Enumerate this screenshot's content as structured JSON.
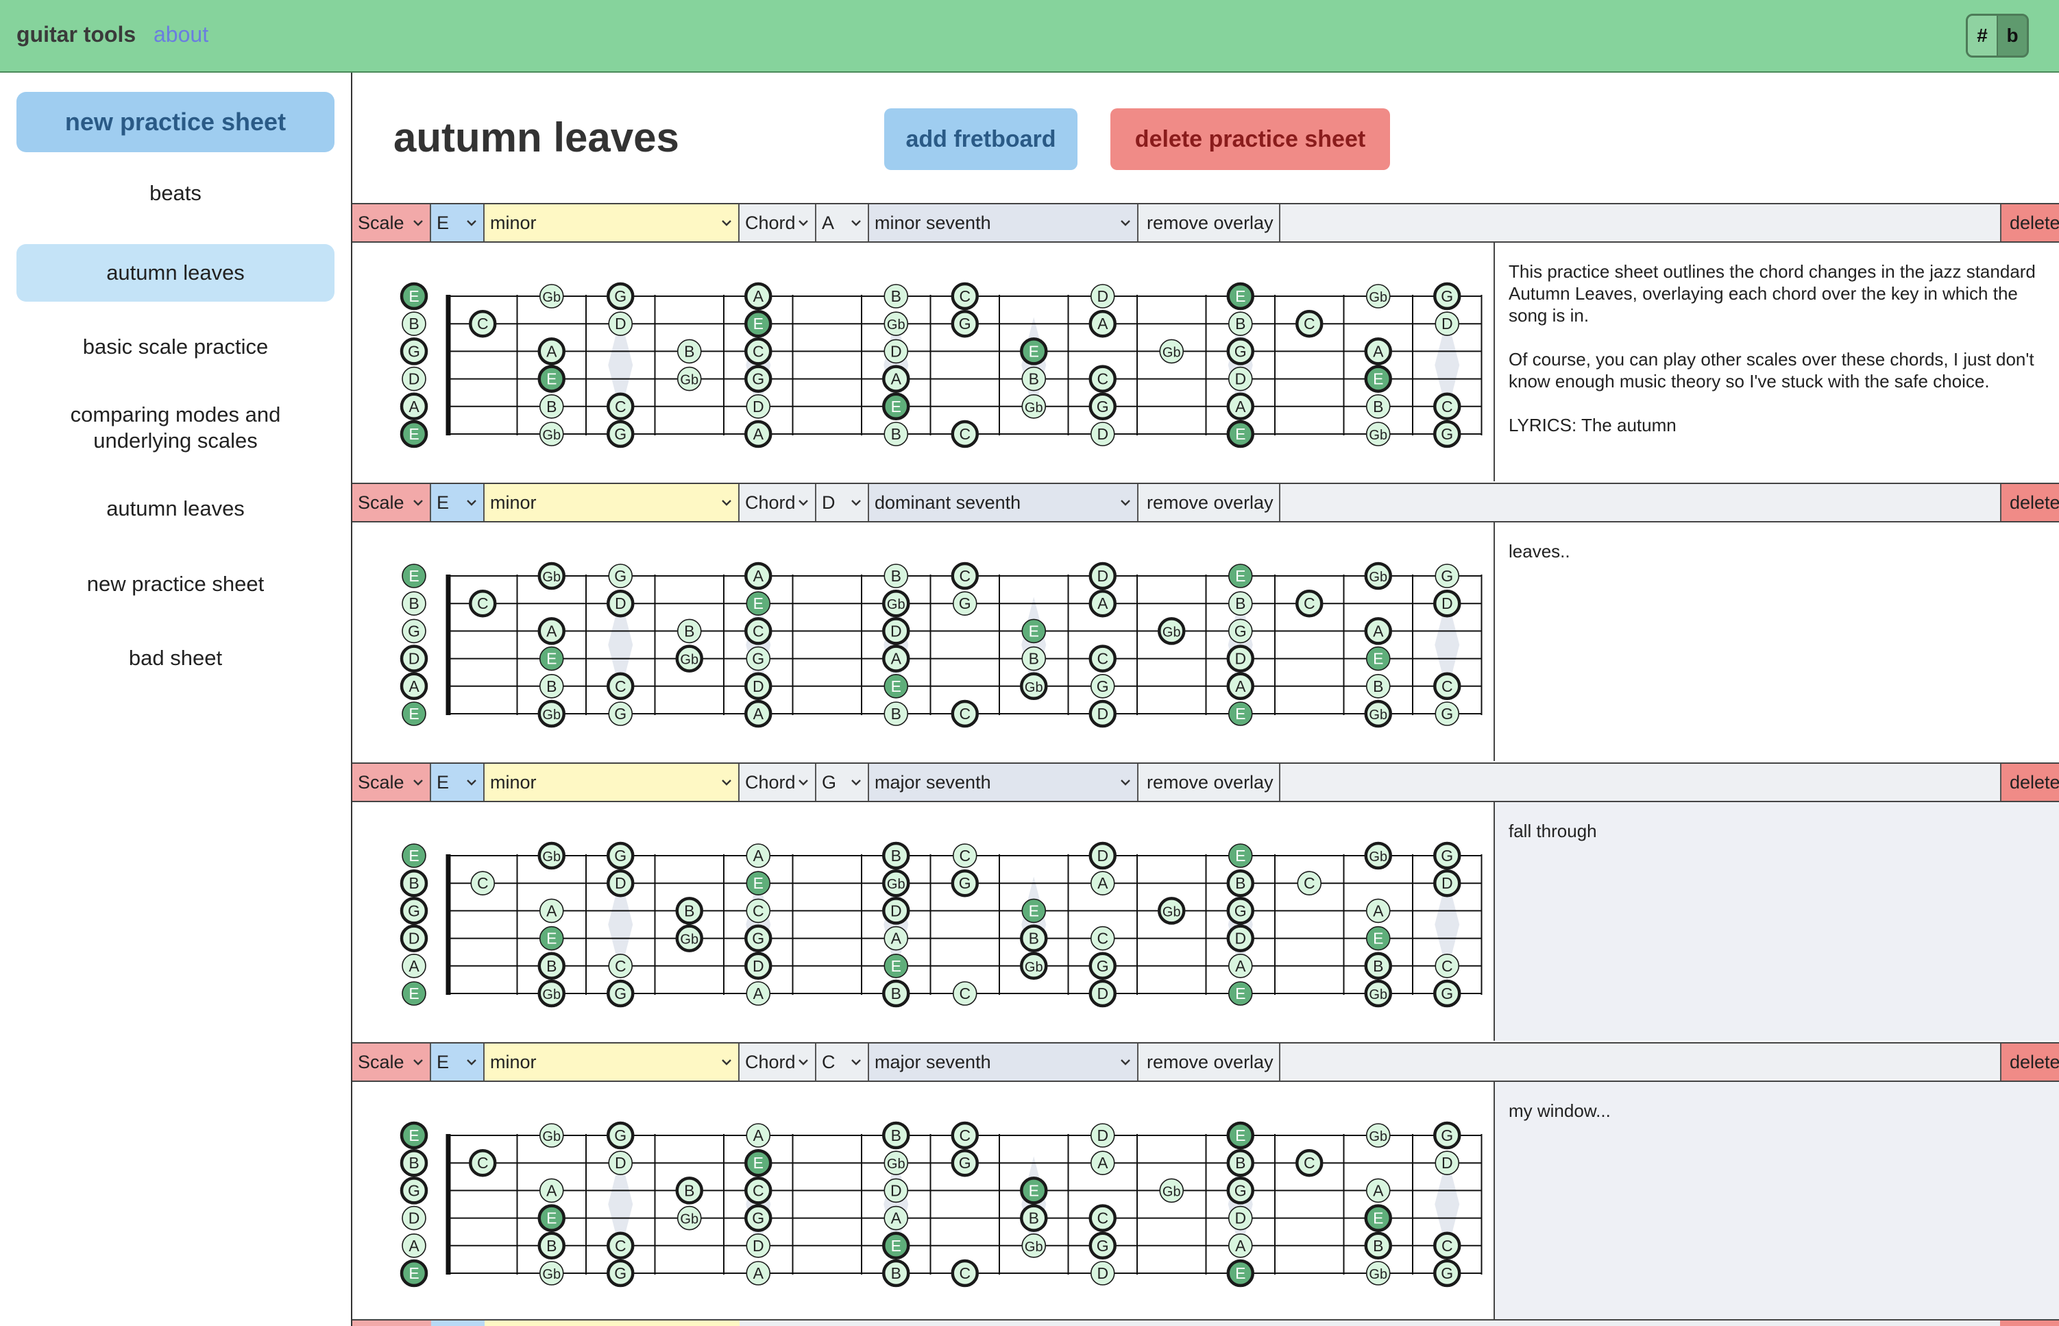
{
  "app": {
    "title": "guitar tools",
    "about_link": "about"
  },
  "accidentals": {
    "sharp": "#",
    "flat": "b",
    "selected": "b"
  },
  "sidebar": {
    "new_button": "new practice sheet",
    "items": [
      {
        "label": "beats",
        "active": false
      },
      {
        "label": "autumn leaves",
        "active": true
      },
      {
        "label": "basic scale practice",
        "active": false
      },
      {
        "label": "comparing modes and underlying scales",
        "active": false
      },
      {
        "label": "autumn leaves",
        "active": false
      },
      {
        "label": "new practice sheet",
        "active": false
      },
      {
        "label": "bad sheet",
        "active": false
      }
    ]
  },
  "sheet": {
    "title": "autumn leaves",
    "add_fretboard_label": "add fretboard",
    "delete_sheet_label": "delete practice sheet"
  },
  "controls": {
    "scale_label": "Scale",
    "chord_label": "Chord",
    "remove_overlay_label": "remove overlay",
    "delete_label": "delete"
  },
  "colors": {
    "topbar": "#86d39c",
    "note_fill_light": "#d9f5df",
    "note_fill_root": "#5fae7a",
    "scale_label_bg": "#f2a9a9",
    "scale_root_bg": "#b8d9f5",
    "scale_type_bg": "#fef8c4",
    "delete_bg": "#f08b87"
  },
  "fretboard": {
    "string_notes": [
      "E",
      "B",
      "G",
      "D",
      "A",
      "E"
    ],
    "frets": [
      [
        "E",
        "B",
        "G",
        "D",
        "A",
        "E"
      ],
      [
        "",
        "C",
        "",
        "",
        "",
        ""
      ],
      [
        "Gb",
        "",
        "A",
        "E",
        "B",
        "Gb"
      ],
      [
        "G",
        "D",
        "",
        "",
        "C",
        "G"
      ],
      [
        "",
        "",
        "B",
        "Gb",
        "",
        ""
      ],
      [
        "A",
        "E",
        "C",
        "G",
        "D",
        "A"
      ],
      [
        "",
        "",
        "",
        "",
        "",
        ""
      ],
      [
        "B",
        "Gb",
        "D",
        "A",
        "E",
        "B"
      ],
      [
        "C",
        "G",
        "",
        "",
        "",
        "C"
      ],
      [
        "",
        "",
        "E",
        "B",
        "Gb",
        ""
      ],
      [
        "D",
        "A",
        "",
        "C",
        "G",
        "D"
      ],
      [
        "",
        "",
        "Gb",
        "",
        "",
        ""
      ],
      [
        "E",
        "B",
        "G",
        "D",
        "A",
        "E"
      ],
      [
        "",
        "C",
        "",
        "",
        "",
        ""
      ],
      [
        "Gb",
        "",
        "A",
        "E",
        "B",
        "Gb"
      ],
      [
        "G",
        "D",
        "",
        "",
        "C",
        "G"
      ]
    ]
  },
  "fretboards": [
    {
      "scale_root": "E",
      "scale_type": "minor",
      "chord_root": "A",
      "chord_type": "minor seventh",
      "chord_tones": [
        "A",
        "C",
        "E",
        "G"
      ],
      "notes": [
        "This practice sheet outlines the chord changes in the jazz standard Autumn Leaves, overlaying each chord over the key in which the song is in.",
        "Of course, you can play other scales over these chords, I just don't know enough music theory so I've stuck with the safe choice.",
        "LYRICS: The autumn"
      ]
    },
    {
      "scale_root": "E",
      "scale_type": "minor",
      "chord_root": "D",
      "chord_type": "dominant seventh",
      "chord_tones": [
        "D",
        "Gb",
        "A",
        "C"
      ],
      "notes": [
        "leaves.."
      ]
    },
    {
      "scale_root": "E",
      "scale_type": "minor",
      "chord_root": "G",
      "chord_type": "major seventh",
      "chord_tones": [
        "G",
        "B",
        "D",
        "Gb"
      ],
      "notes": [
        "fall through"
      ]
    },
    {
      "scale_root": "E",
      "scale_type": "minor",
      "chord_root": "C",
      "chord_type": "major seventh",
      "chord_tones": [
        "C",
        "E",
        "G",
        "B"
      ],
      "notes": [
        "my window..."
      ]
    }
  ]
}
